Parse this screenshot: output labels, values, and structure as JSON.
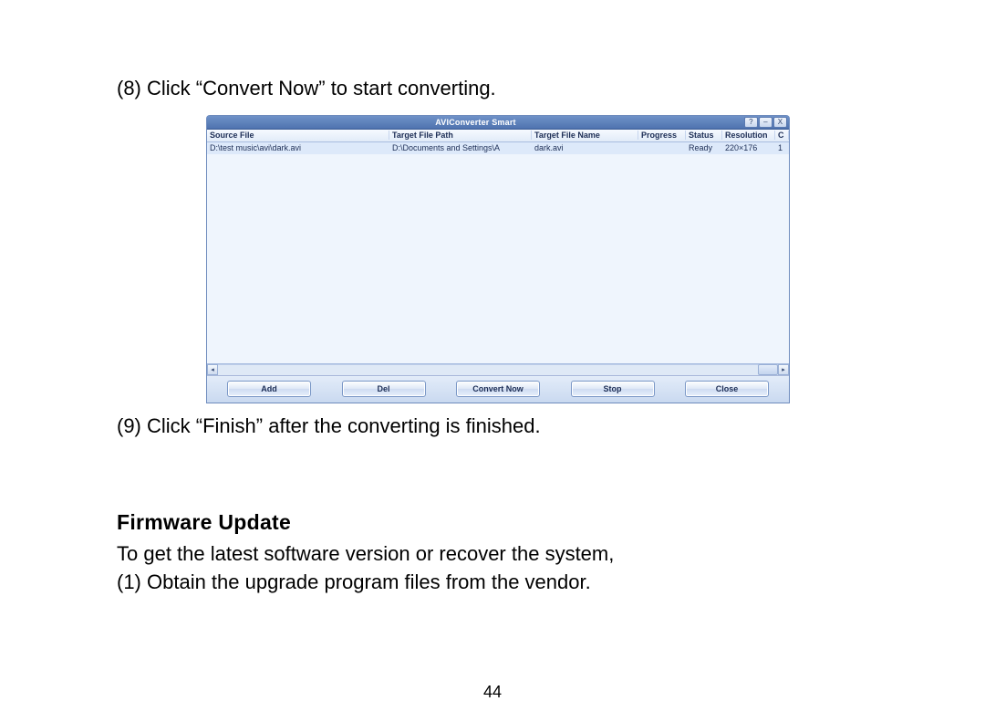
{
  "doc": {
    "step8": "(8)  Click “Convert Now” to start converting.",
    "step9": "(9)  Click “Finish” after the converting is finished.",
    "section_heading": "Firmware Update",
    "section_intro": "To get the latest software version or recover the system,",
    "section_item1": "(1)   Obtain the upgrade program files from the vendor.",
    "page_number": "44"
  },
  "app": {
    "title": "AVIConverter Smart",
    "win_buttons": {
      "help": "?",
      "min": "–",
      "close": "X"
    },
    "columns": {
      "c0": "Source File",
      "c1": "Target File Path",
      "c2": "Target File Name",
      "c3": "Progress",
      "c4": "Status",
      "c5": "Resolution",
      "c6": "C"
    },
    "row": {
      "c0": "D:\\test music\\avi\\dark.avi",
      "c1": "D:\\Documents and Settings\\A",
      "c2": "dark.avi",
      "c3": "",
      "c4": "Ready",
      "c5": "220×176",
      "c6": "1"
    },
    "buttons": {
      "add": "Add",
      "del": "Del",
      "convert": "Convert Now",
      "stop": "Stop",
      "close": "Close"
    },
    "scroll_arrows": {
      "left": "◂",
      "right": "▸"
    }
  }
}
